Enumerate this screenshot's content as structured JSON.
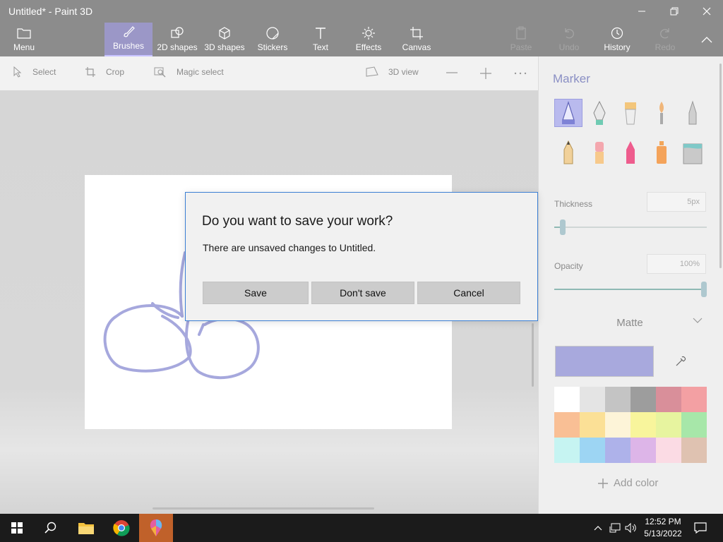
{
  "window": {
    "title": "Untitled* - Paint 3D",
    "minimize_icon": "minimize-icon",
    "restore_icon": "restore-icon",
    "close_icon": "close-icon"
  },
  "ribbon": {
    "menu": "Menu",
    "tabs": [
      {
        "label": "Brushes",
        "icon": "brush-icon",
        "active": true
      },
      {
        "label": "2D shapes",
        "icon": "2d-shapes-icon"
      },
      {
        "label": "3D shapes",
        "icon": "3d-shapes-icon"
      },
      {
        "label": "Stickers",
        "icon": "stickers-icon"
      },
      {
        "label": "Text",
        "icon": "text-icon"
      },
      {
        "label": "Effects",
        "icon": "effects-icon"
      },
      {
        "label": "Canvas",
        "icon": "canvas-icon"
      }
    ],
    "paste": "Paste",
    "undo": "Undo",
    "history": "History",
    "redo": "Redo"
  },
  "toolbar": {
    "select": "Select",
    "crop": "Crop",
    "magic_select": "Magic select",
    "view_3d": "3D view"
  },
  "panel": {
    "heading": "Marker",
    "thickness_label": "Thickness",
    "thickness_value": "5px",
    "opacity_label": "Opacity",
    "opacity_value": "100%",
    "finish": "Matte",
    "add_color": "Add color",
    "current_color": "#a8a9dd",
    "swatches": [
      "#ffffff",
      "#e4e4e4",
      "#c4c4c4",
      "#9d9d9d",
      "#d98f9a",
      "#f3a0a3",
      "#f9bf95",
      "#fbe096",
      "#fdf4d8",
      "#f8f59c",
      "#e7f49f",
      "#a7e7a9",
      "#c6f4f2",
      "#9dd5f3",
      "#aeb2ea",
      "#ddb5e8",
      "#fbdbe4",
      "#dfc2b1"
    ]
  },
  "dialog": {
    "question": "Do you want to save your work?",
    "message": "There are unsaved changes to Untitled.",
    "save": "Save",
    "dont_save": "Don't save",
    "cancel": "Cancel"
  },
  "taskbar": {
    "time": "12:52 PM",
    "date": "5/13/2022"
  }
}
